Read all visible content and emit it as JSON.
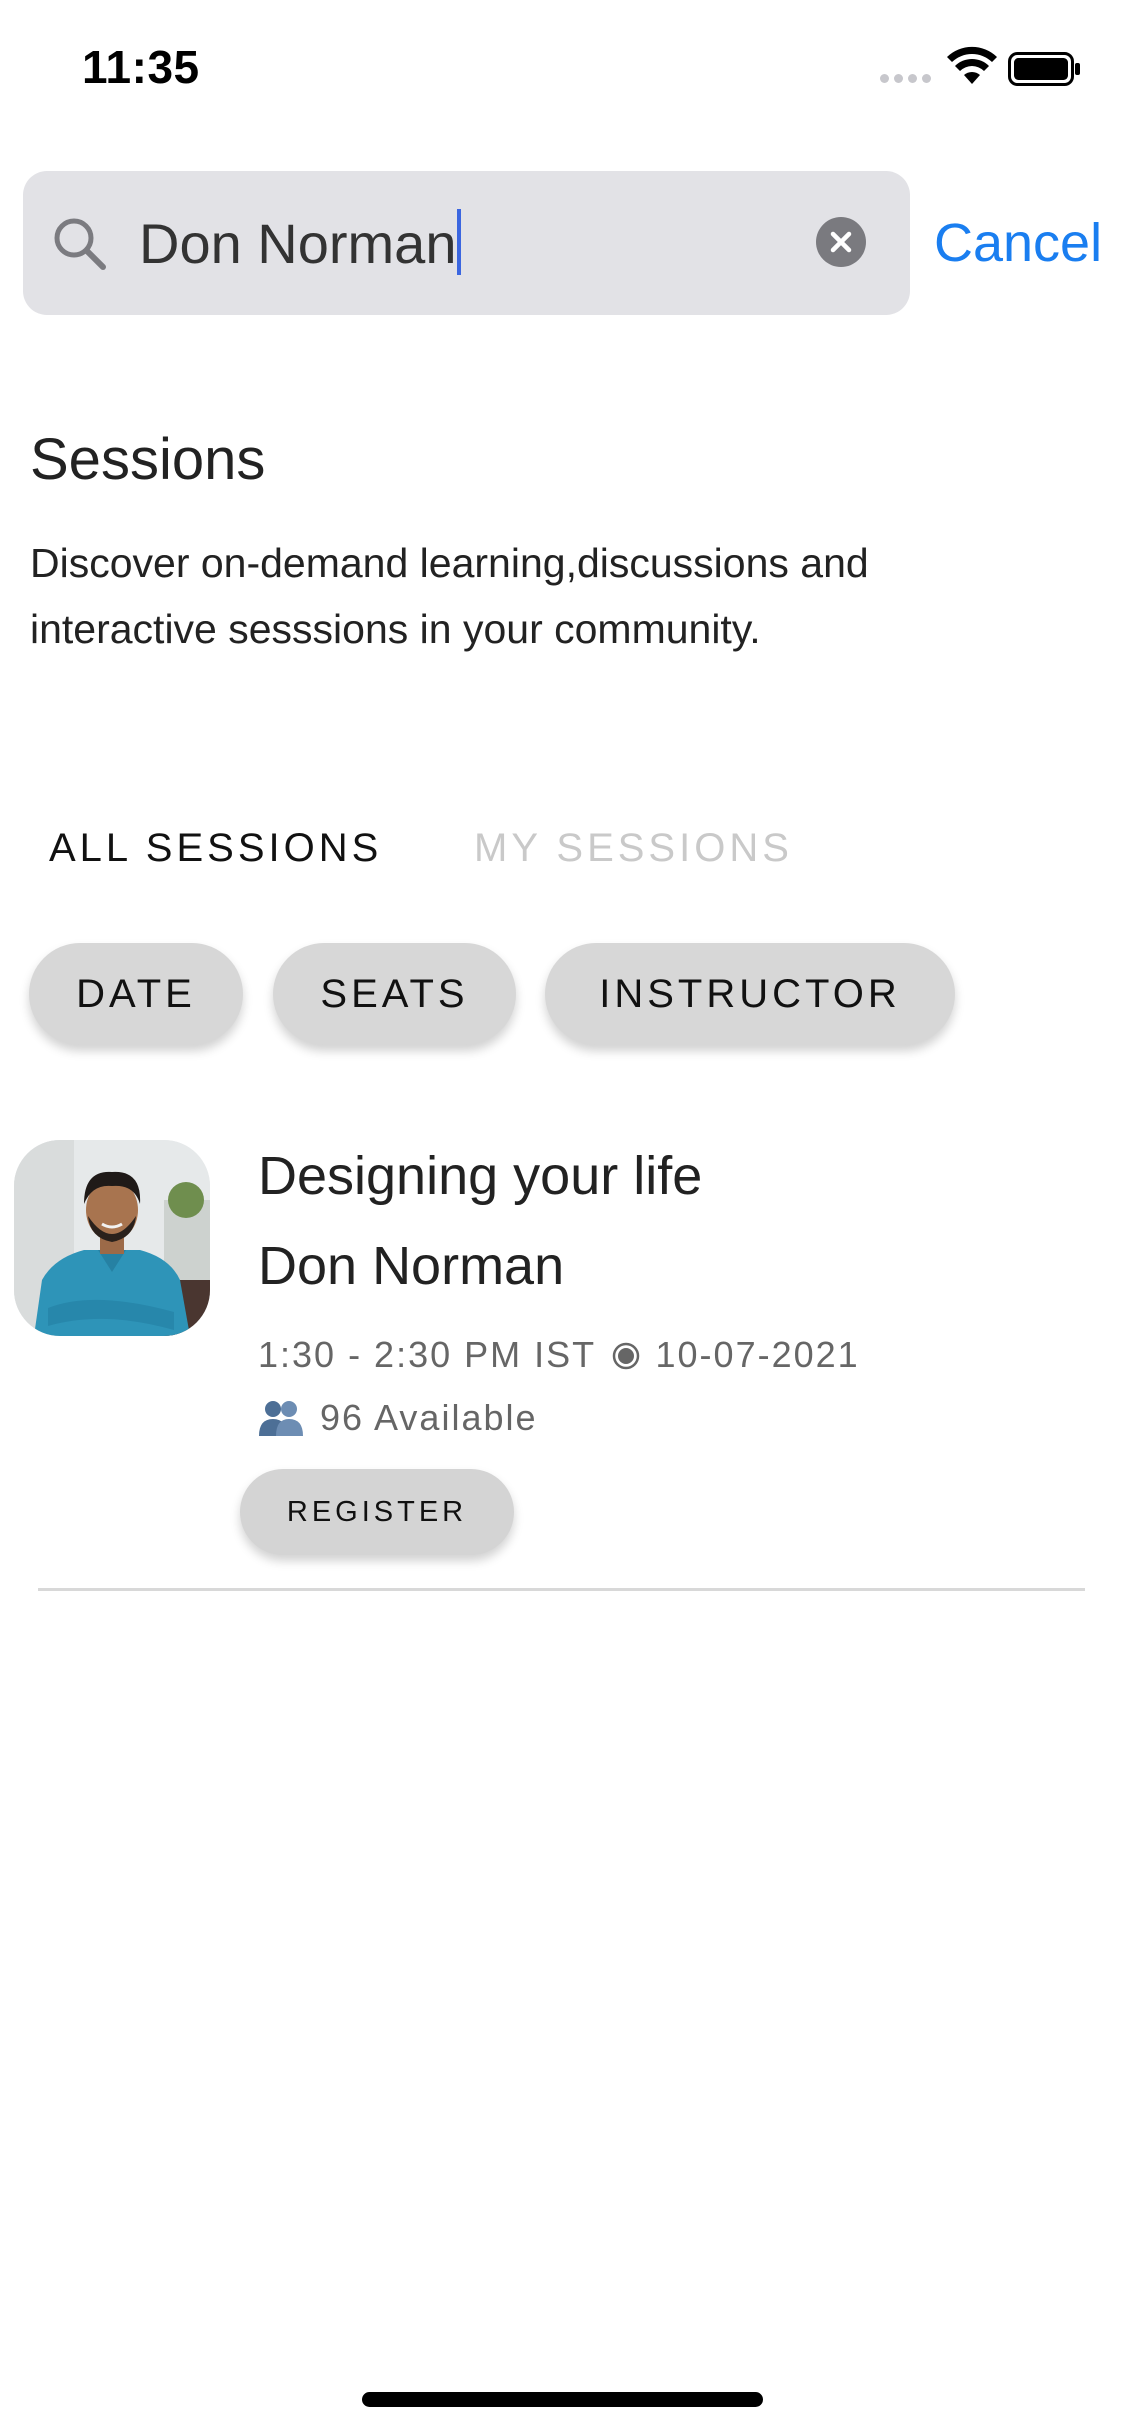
{
  "status_bar": {
    "time": "11:35"
  },
  "search": {
    "query": "Don Norman",
    "cancel_label": "Cancel"
  },
  "page": {
    "title": "Sessions",
    "subtitle": "Discover on-demand learning,discussions and interactive sesssions in your community."
  },
  "tabs": [
    {
      "label": "ALL SESSIONS",
      "active": true
    },
    {
      "label": "MY SESSIONS",
      "active": false
    }
  ],
  "filters": [
    {
      "label": "DATE"
    },
    {
      "label": "SEATS"
    },
    {
      "label": "INSTRUCTOR"
    }
  ],
  "session": {
    "title": "Designing your life",
    "instructor": "Don Norman",
    "time_range": "1:30 - 2:30 PM IST",
    "date": "10-07-2021",
    "availability": "96 Available",
    "register_label": "REGISTER"
  },
  "colors": {
    "accent": "#1a7ef0",
    "caret": "#3b66e0",
    "chip_bg": "#d7d7d7",
    "inactive_tab": "#c9c9c9"
  },
  "icons": {
    "search": "search-icon",
    "clear": "clear-icon",
    "wifi": "wifi-icon",
    "battery": "battery-icon",
    "people": "people-icon",
    "separator": "radio-dot-icon"
  }
}
